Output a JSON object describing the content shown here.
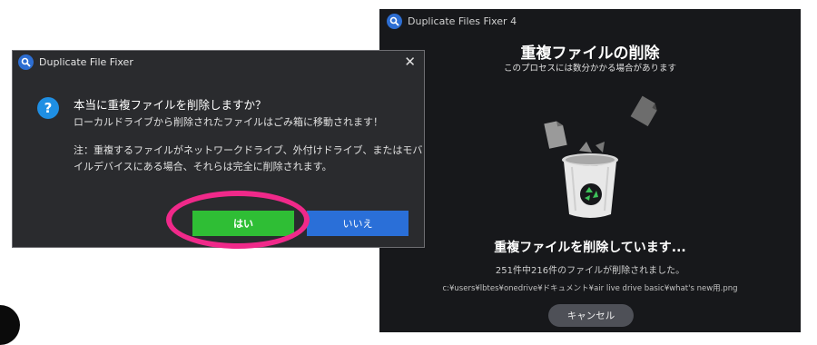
{
  "colors": {
    "right_bg": "#17181b",
    "dialog_bg": "#2a2b2e",
    "yes_green": "#2fbe35",
    "no_blue": "#2a6fd8",
    "highlight_pink": "#f0298a",
    "question_blue": "#1f8fe3"
  },
  "progress_window": {
    "title": "Duplicate Files Fixer 4",
    "heading": "重複ファイルの削除",
    "subheading": "このプロセスには数分かかる場合があります",
    "status": "重複ファイルを削除しています...",
    "count": "251件中216件のファイルが削除されました。",
    "current_path": "c:¥users¥lbtes¥onedrive¥ドキュメント¥air live drive basic¥what's new用.png",
    "cancel_label": "キャンセル",
    "icons": [
      "app-logo-icon",
      "trash-can-icon",
      "recycle-icon",
      "file-icon"
    ]
  },
  "confirm_dialog": {
    "title": "Duplicate File Fixer",
    "close_glyph": "✕",
    "question_glyph": "?",
    "question": "本当に重複ファイルを削除しますか？",
    "info": "ローカルドライブから削除されたファイルはごみ箱に移動されます！",
    "note": "注：重複するファイルがネットワークドライブ、外付けドライブ、またはモバイルデバイスにある場合、それらは完全に削除されます。",
    "yes_label": "はい",
    "no_label": "いいえ"
  }
}
